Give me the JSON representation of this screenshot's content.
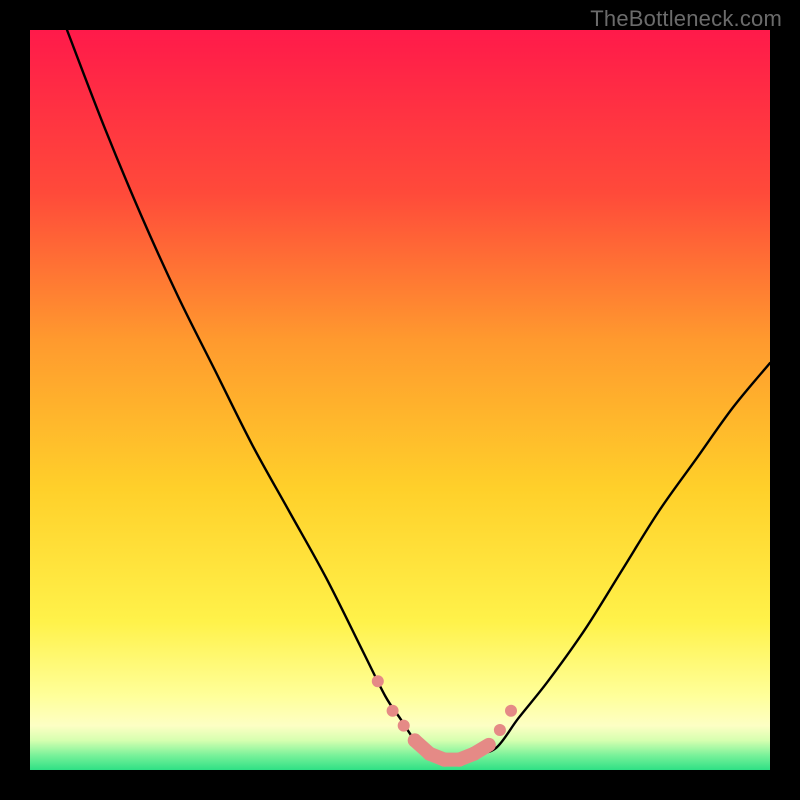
{
  "watermark": "TheBottleneck.com",
  "colors": {
    "gradient_top": "#ff1a4a",
    "gradient_mid_upper": "#ff7a2e",
    "gradient_mid": "#ffd02a",
    "gradient_mid_lower": "#fff24a",
    "gradient_near_bottom": "#ffffa8",
    "gradient_green_light": "#c8ff9a",
    "gradient_green": "#34e58a",
    "curve": "#000000",
    "marker_fill": "#e58a86",
    "marker_stroke": "#d36a66"
  },
  "chart_data": {
    "type": "line",
    "title": "",
    "xlabel": "",
    "ylabel": "",
    "xlim": [
      0,
      100
    ],
    "ylim": [
      0,
      100
    ],
    "series": [
      {
        "name": "bottleneck-curve",
        "x_pct": [
          5,
          10,
          15,
          20,
          25,
          30,
          35,
          40,
          45,
          48,
          50,
          52,
          54,
          56,
          58,
          60,
          63,
          66,
          70,
          75,
          80,
          85,
          90,
          95,
          100
        ],
        "y_pct": [
          100,
          87,
          75,
          64,
          54,
          44,
          35,
          26,
          16,
          10,
          7,
          4,
          2,
          1,
          1,
          2,
          3,
          7,
          12,
          19,
          27,
          35,
          42,
          49,
          55
        ]
      }
    ],
    "markers": {
      "name": "highlighted-points",
      "x_pct": [
        47,
        49,
        50.5,
        52,
        54,
        56,
        58,
        60,
        62,
        63.5,
        65
      ],
      "y_pct": [
        12,
        8,
        6,
        4,
        2.2,
        1.4,
        1.4,
        2.2,
        3.4,
        5.4,
        8
      ]
    }
  }
}
